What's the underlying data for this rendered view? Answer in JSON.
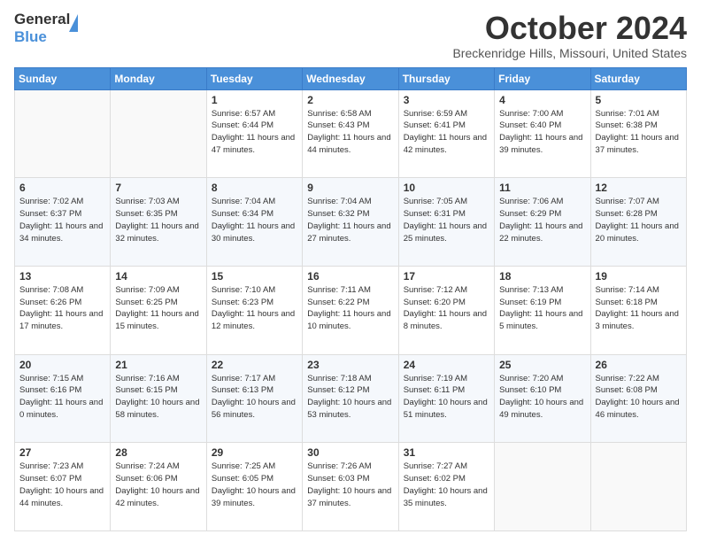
{
  "header": {
    "logo_general": "General",
    "logo_blue": "Blue",
    "month_title": "October 2024",
    "location": "Breckenridge Hills, Missouri, United States"
  },
  "calendar": {
    "days_of_week": [
      "Sunday",
      "Monday",
      "Tuesday",
      "Wednesday",
      "Thursday",
      "Friday",
      "Saturday"
    ],
    "weeks": [
      [
        {
          "day": "",
          "sunrise": "",
          "sunset": "",
          "daylight": "",
          "empty": true
        },
        {
          "day": "",
          "sunrise": "",
          "sunset": "",
          "daylight": "",
          "empty": true
        },
        {
          "day": "1",
          "sunrise": "Sunrise: 6:57 AM",
          "sunset": "Sunset: 6:44 PM",
          "daylight": "Daylight: 11 hours and 47 minutes.",
          "empty": false
        },
        {
          "day": "2",
          "sunrise": "Sunrise: 6:58 AM",
          "sunset": "Sunset: 6:43 PM",
          "daylight": "Daylight: 11 hours and 44 minutes.",
          "empty": false
        },
        {
          "day": "3",
          "sunrise": "Sunrise: 6:59 AM",
          "sunset": "Sunset: 6:41 PM",
          "daylight": "Daylight: 11 hours and 42 minutes.",
          "empty": false
        },
        {
          "day": "4",
          "sunrise": "Sunrise: 7:00 AM",
          "sunset": "Sunset: 6:40 PM",
          "daylight": "Daylight: 11 hours and 39 minutes.",
          "empty": false
        },
        {
          "day": "5",
          "sunrise": "Sunrise: 7:01 AM",
          "sunset": "Sunset: 6:38 PM",
          "daylight": "Daylight: 11 hours and 37 minutes.",
          "empty": false
        }
      ],
      [
        {
          "day": "6",
          "sunrise": "Sunrise: 7:02 AM",
          "sunset": "Sunset: 6:37 PM",
          "daylight": "Daylight: 11 hours and 34 minutes.",
          "empty": false
        },
        {
          "day": "7",
          "sunrise": "Sunrise: 7:03 AM",
          "sunset": "Sunset: 6:35 PM",
          "daylight": "Daylight: 11 hours and 32 minutes.",
          "empty": false
        },
        {
          "day": "8",
          "sunrise": "Sunrise: 7:04 AM",
          "sunset": "Sunset: 6:34 PM",
          "daylight": "Daylight: 11 hours and 30 minutes.",
          "empty": false
        },
        {
          "day": "9",
          "sunrise": "Sunrise: 7:04 AM",
          "sunset": "Sunset: 6:32 PM",
          "daylight": "Daylight: 11 hours and 27 minutes.",
          "empty": false
        },
        {
          "day": "10",
          "sunrise": "Sunrise: 7:05 AM",
          "sunset": "Sunset: 6:31 PM",
          "daylight": "Daylight: 11 hours and 25 minutes.",
          "empty": false
        },
        {
          "day": "11",
          "sunrise": "Sunrise: 7:06 AM",
          "sunset": "Sunset: 6:29 PM",
          "daylight": "Daylight: 11 hours and 22 minutes.",
          "empty": false
        },
        {
          "day": "12",
          "sunrise": "Sunrise: 7:07 AM",
          "sunset": "Sunset: 6:28 PM",
          "daylight": "Daylight: 11 hours and 20 minutes.",
          "empty": false
        }
      ],
      [
        {
          "day": "13",
          "sunrise": "Sunrise: 7:08 AM",
          "sunset": "Sunset: 6:26 PM",
          "daylight": "Daylight: 11 hours and 17 minutes.",
          "empty": false
        },
        {
          "day": "14",
          "sunrise": "Sunrise: 7:09 AM",
          "sunset": "Sunset: 6:25 PM",
          "daylight": "Daylight: 11 hours and 15 minutes.",
          "empty": false
        },
        {
          "day": "15",
          "sunrise": "Sunrise: 7:10 AM",
          "sunset": "Sunset: 6:23 PM",
          "daylight": "Daylight: 11 hours and 12 minutes.",
          "empty": false
        },
        {
          "day": "16",
          "sunrise": "Sunrise: 7:11 AM",
          "sunset": "Sunset: 6:22 PM",
          "daylight": "Daylight: 11 hours and 10 minutes.",
          "empty": false
        },
        {
          "day": "17",
          "sunrise": "Sunrise: 7:12 AM",
          "sunset": "Sunset: 6:20 PM",
          "daylight": "Daylight: 11 hours and 8 minutes.",
          "empty": false
        },
        {
          "day": "18",
          "sunrise": "Sunrise: 7:13 AM",
          "sunset": "Sunset: 6:19 PM",
          "daylight": "Daylight: 11 hours and 5 minutes.",
          "empty": false
        },
        {
          "day": "19",
          "sunrise": "Sunrise: 7:14 AM",
          "sunset": "Sunset: 6:18 PM",
          "daylight": "Daylight: 11 hours and 3 minutes.",
          "empty": false
        }
      ],
      [
        {
          "day": "20",
          "sunrise": "Sunrise: 7:15 AM",
          "sunset": "Sunset: 6:16 PM",
          "daylight": "Daylight: 11 hours and 0 minutes.",
          "empty": false
        },
        {
          "day": "21",
          "sunrise": "Sunrise: 7:16 AM",
          "sunset": "Sunset: 6:15 PM",
          "daylight": "Daylight: 10 hours and 58 minutes.",
          "empty": false
        },
        {
          "day": "22",
          "sunrise": "Sunrise: 7:17 AM",
          "sunset": "Sunset: 6:13 PM",
          "daylight": "Daylight: 10 hours and 56 minutes.",
          "empty": false
        },
        {
          "day": "23",
          "sunrise": "Sunrise: 7:18 AM",
          "sunset": "Sunset: 6:12 PM",
          "daylight": "Daylight: 10 hours and 53 minutes.",
          "empty": false
        },
        {
          "day": "24",
          "sunrise": "Sunrise: 7:19 AM",
          "sunset": "Sunset: 6:11 PM",
          "daylight": "Daylight: 10 hours and 51 minutes.",
          "empty": false
        },
        {
          "day": "25",
          "sunrise": "Sunrise: 7:20 AM",
          "sunset": "Sunset: 6:10 PM",
          "daylight": "Daylight: 10 hours and 49 minutes.",
          "empty": false
        },
        {
          "day": "26",
          "sunrise": "Sunrise: 7:22 AM",
          "sunset": "Sunset: 6:08 PM",
          "daylight": "Daylight: 10 hours and 46 minutes.",
          "empty": false
        }
      ],
      [
        {
          "day": "27",
          "sunrise": "Sunrise: 7:23 AM",
          "sunset": "Sunset: 6:07 PM",
          "daylight": "Daylight: 10 hours and 44 minutes.",
          "empty": false
        },
        {
          "day": "28",
          "sunrise": "Sunrise: 7:24 AM",
          "sunset": "Sunset: 6:06 PM",
          "daylight": "Daylight: 10 hours and 42 minutes.",
          "empty": false
        },
        {
          "day": "29",
          "sunrise": "Sunrise: 7:25 AM",
          "sunset": "Sunset: 6:05 PM",
          "daylight": "Daylight: 10 hours and 39 minutes.",
          "empty": false
        },
        {
          "day": "30",
          "sunrise": "Sunrise: 7:26 AM",
          "sunset": "Sunset: 6:03 PM",
          "daylight": "Daylight: 10 hours and 37 minutes.",
          "empty": false
        },
        {
          "day": "31",
          "sunrise": "Sunrise: 7:27 AM",
          "sunset": "Sunset: 6:02 PM",
          "daylight": "Daylight: 10 hours and 35 minutes.",
          "empty": false
        },
        {
          "day": "",
          "sunrise": "",
          "sunset": "",
          "daylight": "",
          "empty": true
        },
        {
          "day": "",
          "sunrise": "",
          "sunset": "",
          "daylight": "",
          "empty": true
        }
      ]
    ]
  }
}
